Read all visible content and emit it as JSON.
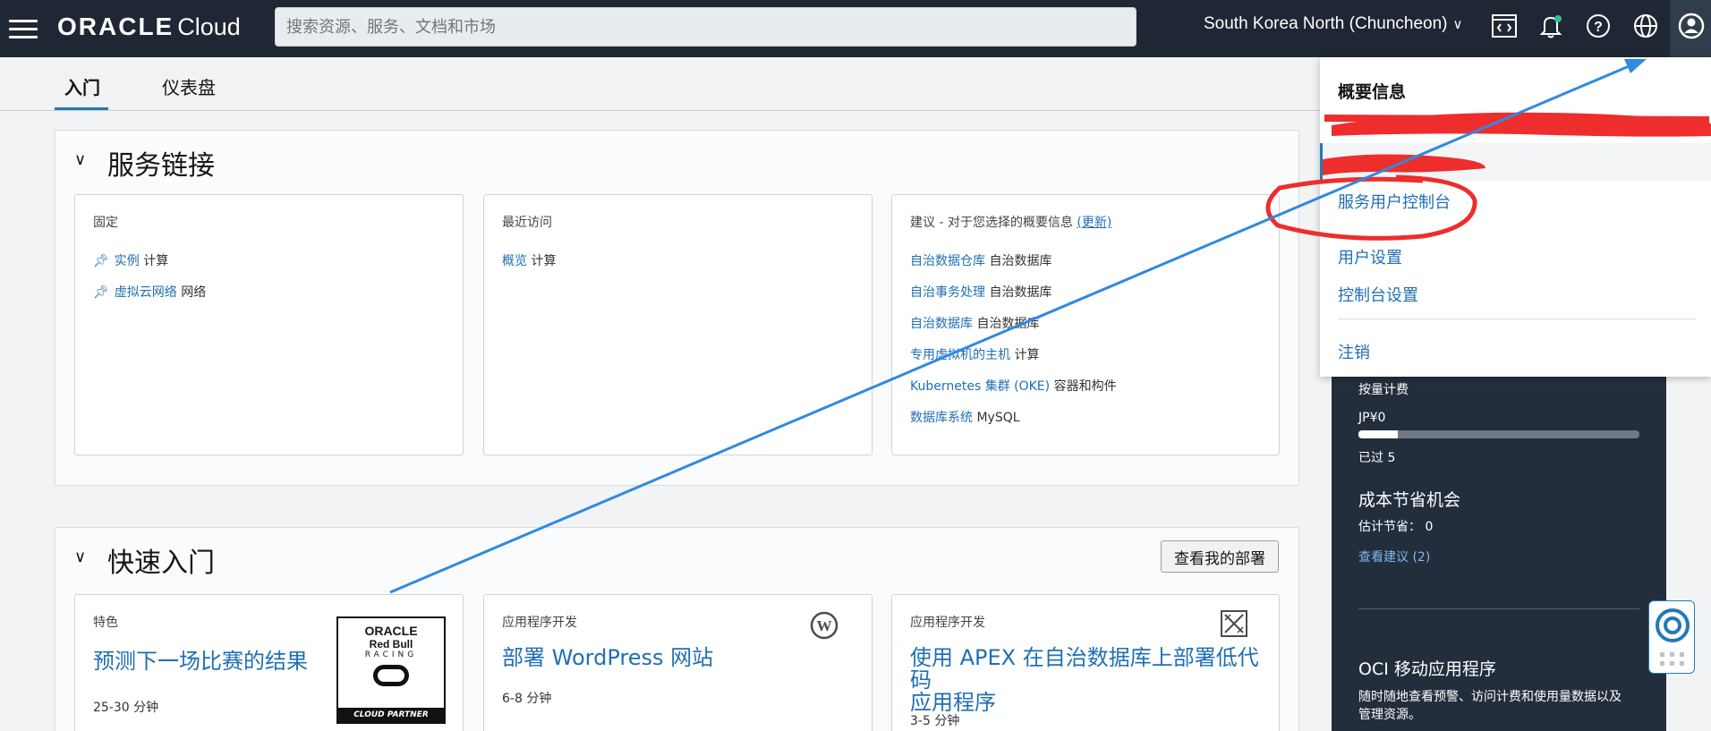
{
  "header": {
    "logo_brand": "ORACLE",
    "logo_product": "Cloud",
    "search_placeholder": "搜索资源、服务、文档和市场",
    "region": "South Korea North (Chuncheon)"
  },
  "tabs": [
    {
      "label": "入门",
      "active": true
    },
    {
      "label": "仪表盘",
      "active": false
    }
  ],
  "service_links": {
    "title": "服务链接",
    "pinned": {
      "heading": "固定",
      "items": [
        {
          "link": "实例",
          "category": "计算"
        },
        {
          "link": "虚拟云网络",
          "category": "网络"
        }
      ]
    },
    "recent": {
      "heading": "最近访问",
      "items": [
        {
          "link": "概览",
          "category": "计算"
        }
      ]
    },
    "suggested": {
      "heading": "建议 - 对于您选择的概要信息",
      "update_link": "(更新)",
      "items": [
        {
          "link": "自治数据仓库",
          "category": "自治数据库"
        },
        {
          "link": "自治事务处理",
          "category": "自治数据库"
        },
        {
          "link": "自治数据库",
          "category": "自治数据库"
        },
        {
          "link": "专用虚拟机的主机",
          "category": "计算"
        },
        {
          "link": "Kubernetes 集群 (OKE)",
          "category": "容器和构件"
        },
        {
          "link": "数据库系统",
          "category": "MySQL"
        }
      ]
    }
  },
  "quick_start": {
    "title": "快速入门",
    "deployments_button": "查看我的部署",
    "cards": [
      {
        "heading": "特色",
        "title": "预测下一场比赛的结果",
        "time": "25-30 分钟"
      },
      {
        "heading": "应用程序开发",
        "title": "部署 WordPress 网站",
        "time": "6-8 分钟"
      },
      {
        "heading": "应用程序开发",
        "title_line1": "使用 APEX 在自治数据库上部署低代码",
        "title_line2": "应用程序",
        "time": "3-5 分钟"
      }
    ],
    "badge": {
      "line1": "ORACLE",
      "line2": "Red Bull",
      "line3": "RACING",
      "line4": "CLOUD PARTNER"
    }
  },
  "billing": {
    "label": "按量计费",
    "amount": "JP¥0",
    "progress": 0.14,
    "days_passed": "已过 5",
    "savings_title": "成本节省机会",
    "savings_label": "估计节省：",
    "savings_value": "0",
    "view_suggestions": "查看建议 (2)",
    "mobile_title": "OCI 移动应用程序",
    "mobile_desc_line1": "随时随地查看预警、访问计费和使用量数据以及",
    "mobile_desc_line2": "管理资源。"
  },
  "profile_menu": {
    "title": "概要信息",
    "items": [
      {
        "label": "服务用户控制台"
      },
      {
        "label": "用户设置"
      },
      {
        "label": "控制台设置"
      },
      {
        "label": "注销"
      }
    ]
  },
  "colors": {
    "header_bg": "#1e2733",
    "link": "#1f6fb4",
    "annotation_red": "#ee2d2d",
    "annotation_blue": "#2f8ae0"
  }
}
